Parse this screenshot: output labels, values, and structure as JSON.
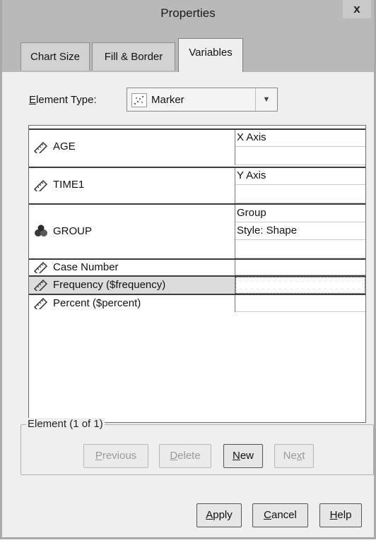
{
  "window": {
    "title": "Properties",
    "close_label": "x"
  },
  "tabs": [
    {
      "label": "Chart Size",
      "active": false
    },
    {
      "label": "Fill & Border",
      "active": false
    },
    {
      "label": "Variables",
      "active": true
    }
  ],
  "element_type": {
    "label_first": "E",
    "label_rest": "lement Type:",
    "value": "Marker",
    "icon": "scatter-marker-icon"
  },
  "variables": [
    {
      "name": "AGE",
      "icon": "ruler-icon",
      "roles": [
        "X Axis",
        ""
      ]
    },
    {
      "name": "TIME1",
      "icon": "ruler-icon",
      "roles": [
        "Y Axis",
        ""
      ]
    },
    {
      "name": "GROUP",
      "icon": "nominal-icon",
      "roles": [
        "Group",
        "Style: Shape",
        ""
      ]
    },
    {
      "name": "Case Number",
      "icon": "ruler-icon",
      "roles": [
        ""
      ]
    },
    {
      "name": "Frequency ($frequency)",
      "icon": "ruler-icon",
      "roles": [
        ""
      ],
      "selected": true
    },
    {
      "name": "Percent ($percent)",
      "icon": "ruler-icon",
      "roles": [
        ""
      ]
    }
  ],
  "element_group": {
    "label": "Element (1 of 1)",
    "previous": {
      "first": "P",
      "rest": "revious"
    },
    "delete": {
      "first": "D",
      "rest": "elete"
    },
    "new": {
      "first": "N",
      "rest": "ew"
    },
    "next": {
      "first": "Ne",
      "mid": "x",
      "rest": "t"
    }
  },
  "footer": {
    "apply": {
      "first": "A",
      "rest": "pply"
    },
    "cancel": {
      "first": "C",
      "rest": "ancel"
    },
    "help": {
      "first": "H",
      "rest": "elp"
    }
  },
  "colors": {
    "titlebar": "#b9b9b9",
    "dialog": "#efefef",
    "selected_row": "#dcdcdc"
  }
}
